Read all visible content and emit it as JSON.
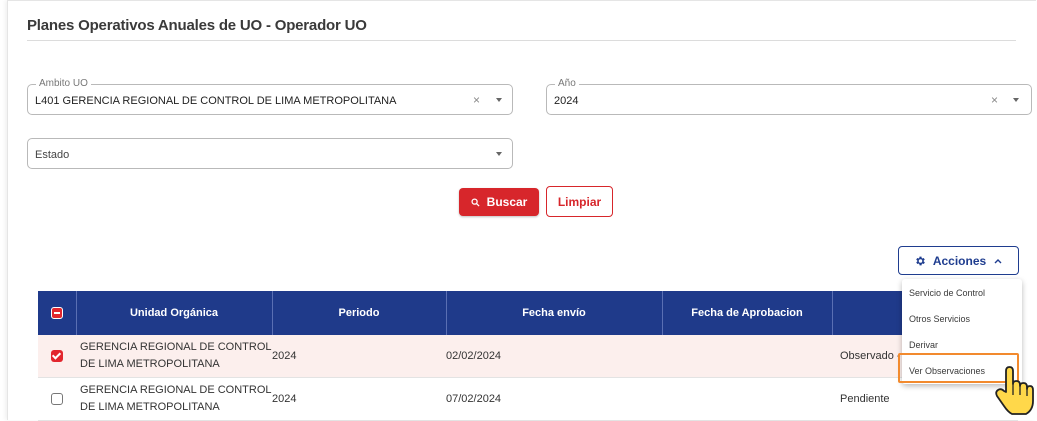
{
  "header": {
    "title": "Planes Operativos Anuales de UO - Operador UO"
  },
  "filters": {
    "ambito": {
      "label": "Ambito UO",
      "value": "L401 GERENCIA REGIONAL DE CONTROL DE LIMA METROPOLITANA",
      "clear": "×"
    },
    "anio": {
      "label": "Año",
      "value": "2024",
      "clear": "×"
    },
    "estado": {
      "placeholder": "Estado"
    }
  },
  "buttons": {
    "search": "Buscar",
    "clear": "Limpiar",
    "actions": "Acciones"
  },
  "table": {
    "columns": [
      "Unidad Orgánica",
      "Periodo",
      "Fecha envío",
      "Fecha de Aprobacion",
      ""
    ],
    "rows": [
      {
        "unit_line1": "GERENCIA REGIONAL DE CONTROL",
        "unit_line2": "DE LIMA METROPOLITANA",
        "period": "2024",
        "sent": "02/02/2024",
        "approval": "",
        "status": "Observado -",
        "selected": true
      },
      {
        "unit_line1": "GERENCIA REGIONAL DE CONTROL",
        "unit_line2": "DE LIMA METROPOLITANA",
        "period": "2024",
        "sent": "07/02/2024",
        "approval": "",
        "status": "Pendiente",
        "selected": false
      }
    ]
  },
  "actions_menu": {
    "items": [
      "Servicio de Control",
      "Otros Servicios",
      "Derivar",
      "Ver Observaciones"
    ],
    "highlighted": "Ver Observaciones"
  },
  "colors": {
    "primary_red": "#d7262b",
    "navy": "#1f3a8a",
    "highlight_orange": "#f28a2e",
    "cursor_yellow": "#ffd84a"
  },
  "icons": [
    "search-icon",
    "gear-icon",
    "chevron-up-icon",
    "chevron-down-icon",
    "clear-icon",
    "hand-pointer-icon"
  ]
}
